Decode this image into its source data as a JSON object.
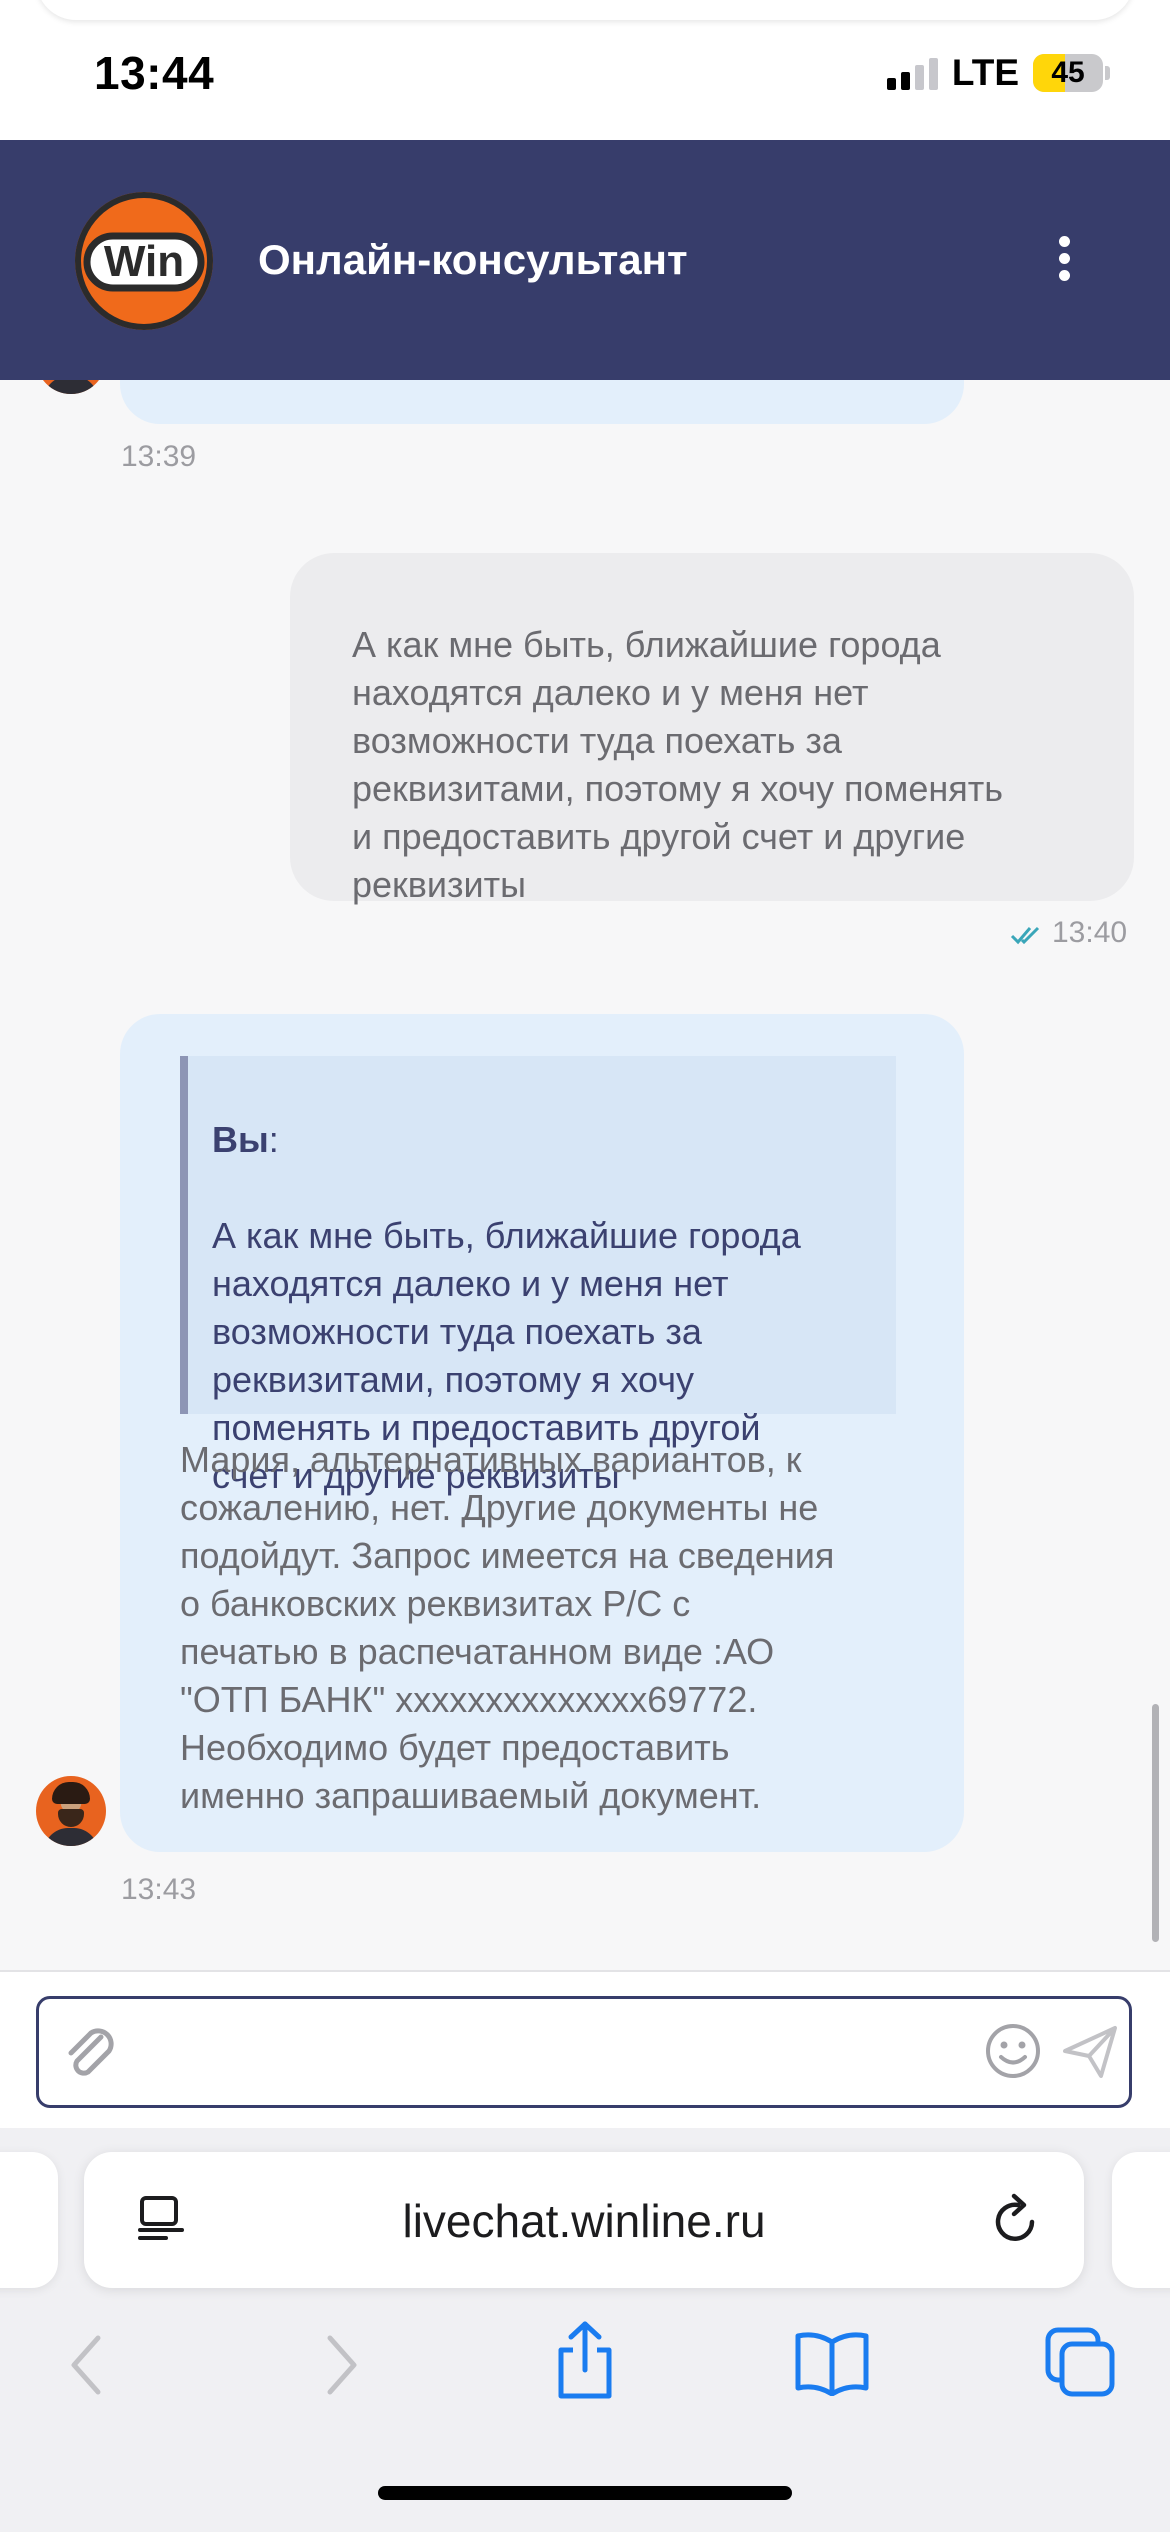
{
  "status_bar": {
    "time": "13:44",
    "network": "LTE",
    "battery_level": "45",
    "battery_color": "#ffd60a",
    "signal_bars_on": 2,
    "signal_bars_total": 4
  },
  "header": {
    "logo_text": "Win",
    "title": "Онлайн-консультант",
    "menu_icon": "more-vertical-icon",
    "background": "#373d6b",
    "logo_color": "#f06a1b"
  },
  "messages": [
    {
      "type": "incoming-partial",
      "time": "13:39"
    },
    {
      "type": "outgoing",
      "text": "А как мне быть, ближайшие города\nнаходятся далеко и у меня нет\nвозможности туда поехать за\nреквизитами, поэтому я хочу поменять\nи предоставить другой счет и другие\nреквизиты",
      "time": "13:40",
      "status_icon": "double-check-icon"
    },
    {
      "type": "incoming",
      "quote_author": "Вы",
      "quote_text": "А как мне быть, ближайшие города\nнаходятся далеко и у меня нет\nвозможности туда поехать за\nреквизитами, поэтому я хочу\nпоменять и предоставить другой\nсчет и другие реквизиты",
      "text": "Мария, альтернативных вариантов, к\nсожалению, нет. Другие документы не\nподойдут. Запрос имеется на сведения\nо банковских реквизитах Р/С с\nпечатью в распечатанном виде :АО\n\"ОТП БАНК\" хххххххххххххх69772.\nНеобходимо будет предоставить\nименно запрашиваемый документ.",
      "time": "13:43"
    }
  ],
  "composer": {
    "placeholder": "",
    "attach_icon": "paperclip-icon",
    "emoji_icon": "smiley-icon",
    "send_icon": "send-icon"
  },
  "browser": {
    "url": "livechat.winline.ru",
    "reader_icon": "reader-mode-icon",
    "reload_icon": "reload-icon",
    "nav_icons": [
      "back-icon",
      "forward-icon",
      "share-icon",
      "bookmarks-icon",
      "tabs-icon"
    ]
  }
}
